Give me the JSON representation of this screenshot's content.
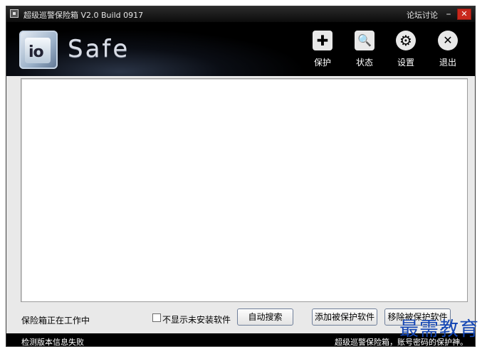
{
  "titlebar": {
    "title": "超级巡警保险箱 V2.0 Build 0917",
    "forum_link": "论坛讨论",
    "minimize_glyph": "–",
    "close_glyph": "✕"
  },
  "header": {
    "logo_text": "io",
    "brand": "Safe"
  },
  "toolbar": {
    "protect": {
      "label": "保护",
      "icon": "plus-icon",
      "glyph": "✚"
    },
    "status": {
      "label": "状态",
      "icon": "magnifier-icon",
      "glyph": "🔍"
    },
    "settings": {
      "label": "设置",
      "icon": "gear-icon",
      "glyph": "⚙"
    },
    "exit": {
      "label": "退出",
      "icon": "close-circle-icon",
      "glyph": "✕"
    }
  },
  "main": {
    "status_text": "保险箱正在工作中",
    "checkbox_label": "不显示未安装软件",
    "checkbox_checked": false,
    "buttons": {
      "auto_search": "自动搜索",
      "add_protected": "添加被保护软件",
      "remove_protected": "移除被保护软件"
    }
  },
  "statusbar": {
    "left": "检测版本信息失败",
    "right": "超级巡警保险箱，账号密码的保护神。"
  },
  "watermark": "最需教育"
}
